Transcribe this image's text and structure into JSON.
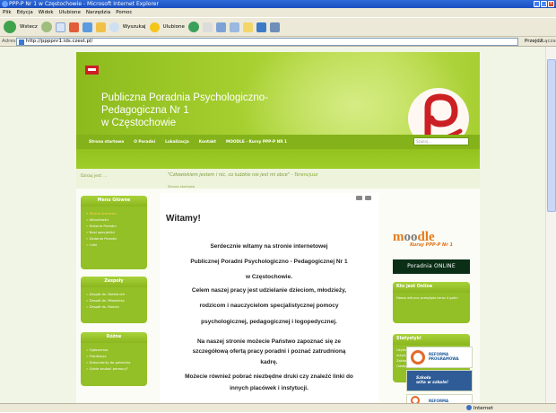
{
  "window": {
    "title": "PPP-P Nr 1 w Częstochowie - Microsoft Internet Explorer"
  },
  "menu": [
    "Plik",
    "Edycja",
    "Widok",
    "Ulubione",
    "Narzędzia",
    "Pomoc"
  ],
  "toolbar": {
    "back_label": "Wstecz",
    "search_label": "Wyszukaj",
    "favorites_label": "Ulubione"
  },
  "address": {
    "label": "Adres",
    "url": "http://ppppnr1.ids.czest.pl/",
    "go_label": "Przejdź",
    "links_label": "Łącza"
  },
  "status": {
    "zone": "Internet"
  },
  "site": {
    "title_lines": [
      "Publiczna Poradnia Psychologiczno-",
      "Pedagogiczna Nr 1",
      "w Częstochowie"
    ],
    "nav": [
      "Strona startowa",
      "O Poradni",
      "Lokalizacja",
      "Kontakt",
      "MOODLE - Kursy PPP-P NR 1"
    ],
    "search_placeholder": "Szukaj...",
    "timestamp": "Dzisiaj jest: ...",
    "quote": "\"Człowiekiem jestem i nic, co ludzkie nie jest mi obce\"",
    "quote_author": "- Terencjusz",
    "breadcrumb": "Strona startowa"
  },
  "left": {
    "main_menu": {
      "title": "Menu Główne",
      "items": [
        "Strona startowa",
        "Aktualności",
        "Historia Poradni",
        "Nasi specjaliści",
        "Zadania Poradni",
        "Linki"
      ]
    },
    "teams": {
      "title": "Zespoły",
      "items": [
        "Zespół ds. Nieletnich",
        "Zespół ds. Młodzieży",
        "Zespół ds. Rodzin"
      ]
    },
    "misc": {
      "title": "Różne",
      "items": [
        "Ogłoszenia",
        "Publikacje",
        "Dokumenty do pobrania",
        "Gdzie szukać pomocy?"
      ]
    }
  },
  "content": {
    "heading": "Witamy!",
    "paragraphs": [
      "Serdecznie witamy na stronie internetowej",
      "Publicznej Poradni Psychologiczno - Pedagogicznej Nr 1",
      "w Częstochowie.",
      "Celem naszej pracy jest udzielanie dzieciom, młodzieży,",
      "rodzicom i nauczycielom specjalistycznej pomocy",
      "psychologicznej, pedagogicznej i logopedycznej.",
      "Na naszej stronie możecie Państwo zapoznać się ze",
      "szczegółową ofertą pracy poradni i poznać zatrudnioną",
      "kadrę.",
      "Możecie również pobrać niezbędne druki czy znaleźć linki do",
      "innych placówek i instytucji."
    ]
  },
  "right": {
    "moodle_prefix": "m",
    "moodle_oo": "oo",
    "moodle_suffix": "dle",
    "moodle_sub": "Kursy PPP-P Nr 1",
    "poradnia_online": "Poradnia ONLINE",
    "who_online": {
      "title": "Kto jest Online",
      "text": "Naszą witrynę przegląda teraz 4 gości"
    },
    "stats": {
      "title": "Statystyki",
      "lines": [
        "Użytkowników: 2",
        "Artykułów: 32",
        "Zakładek: 25",
        "Odsłon: 9365"
      ]
    },
    "banner1": [
      "REFORMA",
      "PROGRAMOWA"
    ],
    "banner2": [
      "Szkoła",
      "wita w szkole!"
    ],
    "banner3": [
      "REFORMA"
    ]
  },
  "colors": {
    "header_green": "#a5cf2e",
    "nav_green": "#84b21a",
    "box_green": "#93bf27",
    "logo_red": "#cc1f24",
    "moodle_orange": "#e87a18"
  }
}
